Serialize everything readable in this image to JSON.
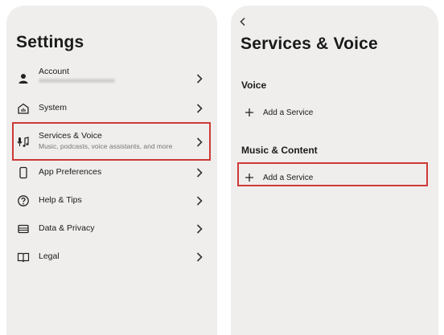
{
  "settings": {
    "title": "Settings",
    "items": [
      {
        "label": "Account",
        "icon": "person-icon"
      },
      {
        "label": "System",
        "icon": "home-icon"
      },
      {
        "label": "Services & Voice",
        "sub": "Music, podcasts, voice assistants, and more",
        "icon": "music-mic-icon"
      },
      {
        "label": "App Preferences",
        "icon": "phone-icon"
      },
      {
        "label": "Help & Tips",
        "icon": "question-icon"
      },
      {
        "label": "Data & Privacy",
        "icon": "card-icon"
      },
      {
        "label": "Legal",
        "icon": "book-icon"
      }
    ]
  },
  "services": {
    "title": "Services & Voice",
    "voice_heading": "Voice",
    "voice_add": "Add a Service",
    "music_heading": "Music & Content",
    "music_add": "Add a Service"
  },
  "colors": {
    "panel": "#efeeed",
    "highlight": "#cd3a36"
  }
}
